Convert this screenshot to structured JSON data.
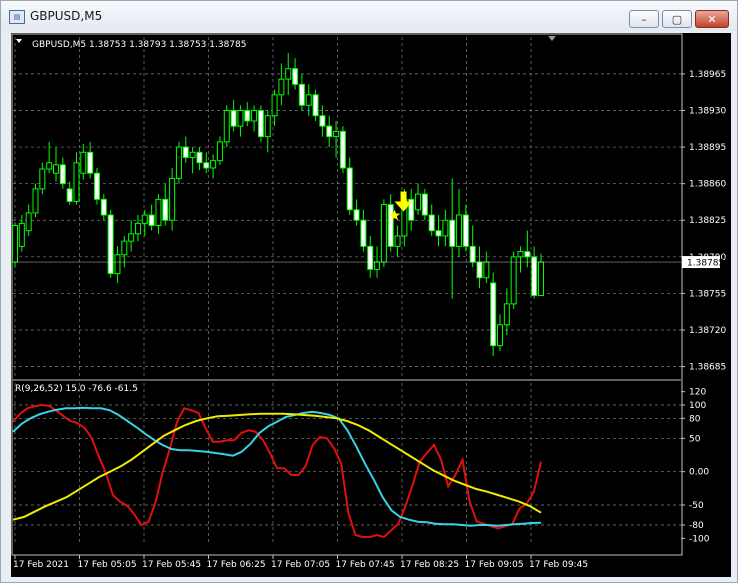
{
  "window": {
    "title": "GBPUSD,M5",
    "icon": "chart-window-icon",
    "buttons": [
      {
        "name": "minimize-button",
        "glyph": "–"
      },
      {
        "name": "restore-button",
        "glyph": "▢"
      },
      {
        "name": "close-button",
        "glyph": "✕"
      }
    ]
  },
  "colors": {
    "background": "#000000",
    "candle": "#00ff00",
    "grid": "#808080",
    "price_line": "#ffffff",
    "marker": "#ffff00",
    "ind_red": "#e01010",
    "ind_cyan": "#37d3e6",
    "ind_yellow": "#f0ea00"
  },
  "chart_data": [
    {
      "type": "candlestick",
      "symbol_header": "GBPUSD,M5  1.38753 1.38793 1.38753 1.38785",
      "current_price": "1.38785",
      "ylim": [
        1.38676,
        1.38985
      ],
      "ytick_values": [
        1.38685,
        1.3872,
        1.38755,
        1.3879,
        1.38825,
        1.3886,
        1.38895,
        1.3893,
        1.38965
      ],
      "ytick_labels": [
        "1.38685",
        "1.38720",
        "1.38755",
        "1.38790",
        "1.38825",
        "1.38860",
        "1.38895",
        "1.38930",
        "1.38965"
      ],
      "x_ticks": [
        "17 Feb 2021",
        "17 Feb 05:05",
        "17 Feb 05:45",
        "17 Feb 06:25",
        "17 Feb 07:05",
        "17 Feb 07:45",
        "17 Feb 08:25",
        "17 Feb 09:05",
        "17 Feb 09:45"
      ],
      "grid": true,
      "ohlc": [
        [
          1.38785,
          1.38823,
          1.3878,
          1.3882
        ],
        [
          1.388,
          1.3883,
          1.38795,
          1.38822
        ],
        [
          1.38815,
          1.3884,
          1.3881,
          1.38832
        ],
        [
          1.38832,
          1.3886,
          1.38828,
          1.38855
        ],
        [
          1.38855,
          1.3888,
          1.3885,
          1.38874
        ],
        [
          1.38874,
          1.389,
          1.3887,
          1.3888
        ],
        [
          1.3887,
          1.38895,
          1.38862,
          1.38878
        ],
        [
          1.38878,
          1.38885,
          1.38855,
          1.3886
        ],
        [
          1.38855,
          1.38862,
          1.3884,
          1.38843
        ],
        [
          1.38843,
          1.3889,
          1.3884,
          1.3888
        ],
        [
          1.3887,
          1.38898,
          1.38864,
          1.3889
        ],
        [
          1.3889,
          1.389,
          1.38865,
          1.3887
        ],
        [
          1.3887,
          1.38875,
          1.3884,
          1.38845
        ],
        [
          1.38845,
          1.3885,
          1.38825,
          1.3883
        ],
        [
          1.3883,
          1.38835,
          1.3877,
          1.38774
        ],
        [
          1.38774,
          1.388,
          1.38765,
          1.38792
        ],
        [
          1.38792,
          1.3881,
          1.3878,
          1.38805
        ],
        [
          1.38805,
          1.38825,
          1.38795,
          1.38812
        ],
        [
          1.38812,
          1.3883,
          1.38805,
          1.38822
        ],
        [
          1.38822,
          1.38835,
          1.3881,
          1.3883
        ],
        [
          1.3883,
          1.3884,
          1.38815,
          1.3882
        ],
        [
          1.3882,
          1.3885,
          1.38812,
          1.38845
        ],
        [
          1.38845,
          1.3886,
          1.3882,
          1.38825
        ],
        [
          1.38825,
          1.38875,
          1.38815,
          1.38865
        ],
        [
          1.38865,
          1.389,
          1.3886,
          1.38895
        ],
        [
          1.38895,
          1.38905,
          1.3888,
          1.38885
        ],
        [
          1.38885,
          1.38895,
          1.3887,
          1.3889
        ],
        [
          1.3889,
          1.38895,
          1.38873,
          1.3888
        ],
        [
          1.3888,
          1.3889,
          1.3887,
          1.38875
        ],
        [
          1.38875,
          1.38888,
          1.38865,
          1.38882
        ],
        [
          1.38882,
          1.38905,
          1.38878,
          1.389
        ],
        [
          1.389,
          1.38935,
          1.38895,
          1.3893
        ],
        [
          1.3893,
          1.3894,
          1.3891,
          1.38915
        ],
        [
          1.38915,
          1.38935,
          1.38905,
          1.3893
        ],
        [
          1.3893,
          1.38938,
          1.38915,
          1.3892
        ],
        [
          1.3892,
          1.38935,
          1.3891,
          1.3893
        ],
        [
          1.3893,
          1.38935,
          1.389,
          1.38905
        ],
        [
          1.38905,
          1.3893,
          1.3889,
          1.38925
        ],
        [
          1.38925,
          1.3895,
          1.38915,
          1.38945
        ],
        [
          1.38945,
          1.38975,
          1.38935,
          1.3896
        ],
        [
          1.3896,
          1.38985,
          1.38945,
          1.3897
        ],
        [
          1.3897,
          1.3898,
          1.3895,
          1.38955
        ],
        [
          1.38955,
          1.38965,
          1.3893,
          1.38935
        ],
        [
          1.38935,
          1.38955,
          1.38925,
          1.38945
        ],
        [
          1.38945,
          1.3895,
          1.3892,
          1.38925
        ],
        [
          1.38925,
          1.38935,
          1.38905,
          1.38915
        ],
        [
          1.38915,
          1.38925,
          1.38895,
          1.38905
        ],
        [
          1.38905,
          1.3892,
          1.38885,
          1.3891
        ],
        [
          1.3891,
          1.38915,
          1.3887,
          1.38875
        ],
        [
          1.38875,
          1.38885,
          1.3883,
          1.38835
        ],
        [
          1.38835,
          1.38845,
          1.3882,
          1.38825
        ],
        [
          1.38825,
          1.38835,
          1.38795,
          1.388
        ],
        [
          1.388,
          1.3881,
          1.3877,
          1.38778
        ],
        [
          1.38778,
          1.388,
          1.3877,
          1.38785
        ],
        [
          1.38785,
          1.38845,
          1.3878,
          1.3884
        ],
        [
          1.3884,
          1.3885,
          1.38795,
          1.388
        ],
        [
          1.388,
          1.3882,
          1.3879,
          1.3881
        ],
        [
          1.3881,
          1.38855,
          1.388,
          1.38845
        ],
        [
          1.38845,
          1.38855,
          1.38815,
          1.38825
        ],
        [
          1.38835,
          1.3886,
          1.3883,
          1.3885
        ],
        [
          1.3885,
          1.38855,
          1.38825,
          1.3883
        ],
        [
          1.3883,
          1.3884,
          1.3881,
          1.38815
        ],
        [
          1.38815,
          1.3883,
          1.388,
          1.3881
        ],
        [
          1.3881,
          1.38835,
          1.388,
          1.38825
        ],
        [
          1.38825,
          1.38865,
          1.3875,
          1.388
        ],
        [
          1.388,
          1.38855,
          1.3879,
          1.3883
        ],
        [
          1.3883,
          1.3884,
          1.38795,
          1.388
        ],
        [
          1.388,
          1.3882,
          1.3878,
          1.38785
        ],
        [
          1.38785,
          1.388,
          1.3876,
          1.3877
        ],
        [
          1.3877,
          1.38795,
          1.38765,
          1.38785
        ],
        [
          1.38765,
          1.38775,
          1.38695,
          1.38705
        ],
        [
          1.38705,
          1.38735,
          1.387,
          1.38725
        ],
        [
          1.38725,
          1.3876,
          1.38715,
          1.38745
        ],
        [
          1.38745,
          1.38795,
          1.3874,
          1.3879
        ],
        [
          1.3879,
          1.388,
          1.38775,
          1.38795
        ],
        [
          1.38795,
          1.38815,
          1.3878,
          1.3879
        ],
        [
          1.3879,
          1.388,
          1.3875,
          1.38753
        ],
        [
          1.38753,
          1.38793,
          1.38753,
          1.38785
        ]
      ],
      "signals": [
        {
          "bar_index": 56,
          "type": "sell-arrow"
        },
        {
          "bar_index": 56,
          "type": "star"
        }
      ]
    },
    {
      "type": "line",
      "header": "R(9,26,52) 15.0 -76.6 -61.5",
      "ylim": [
        -110,
        130
      ],
      "ytick_values": [
        120,
        100,
        80,
        50,
        0,
        -50,
        -80,
        -100
      ],
      "ytick_labels": [
        "120",
        "100",
        "80",
        "50",
        "0.00",
        "-50",
        "-80",
        "-100"
      ],
      "series": [
        {
          "color_key": "ind_red",
          "values": [
            75,
            87,
            95,
            98,
            100,
            99,
            92,
            84,
            76,
            73,
            66,
            51,
            24,
            -2,
            -35,
            -45,
            -51,
            -64,
            -80,
            -75,
            -45,
            0,
            35,
            75,
            95,
            92,
            88,
            65,
            45,
            45,
            47,
            47,
            58,
            62,
            60,
            48,
            28,
            5,
            5,
            -5,
            -5,
            8,
            40,
            52,
            50,
            35,
            12,
            -62,
            -95,
            -98,
            -98,
            -95,
            -98,
            -88,
            -78,
            -52,
            -20,
            15,
            28,
            40,
            18,
            -22,
            -5,
            18,
            -45,
            -75,
            -78,
            -82,
            -85,
            -82,
            -78,
            -55,
            -48,
            -30,
            15
          ]
        },
        {
          "color_key": "ind_cyan",
          "values": [
            60,
            72,
            80,
            86,
            90,
            93,
            95,
            95,
            96,
            95,
            95,
            92,
            85,
            76,
            67,
            57,
            48,
            40,
            34,
            32,
            32,
            31,
            30,
            28,
            26,
            24,
            30,
            42,
            58,
            68,
            75,
            82,
            85,
            88,
            90,
            88,
            85,
            80,
            62,
            38,
            12,
            -12,
            -38,
            -58,
            -68,
            -72,
            -75,
            -76,
            -78,
            -79,
            -79,
            -80,
            -81,
            -80,
            -80,
            -81,
            -80,
            -79,
            -78,
            -77,
            -76.6
          ]
        },
        {
          "color_key": "ind_yellow",
          "values": [
            -72,
            -68,
            -60,
            -52,
            -45,
            -38,
            -28,
            -18,
            -8,
            0,
            8,
            18,
            30,
            42,
            54,
            62,
            70,
            76,
            80,
            83,
            84,
            85,
            86,
            87,
            87,
            87,
            86,
            85,
            84,
            82,
            80,
            76,
            70,
            62,
            52,
            42,
            32,
            22,
            12,
            2,
            -6,
            -14,
            -20,
            -26,
            -30,
            -35,
            -40,
            -45,
            -52,
            -61.5
          ]
        }
      ],
      "grid": true
    }
  ]
}
